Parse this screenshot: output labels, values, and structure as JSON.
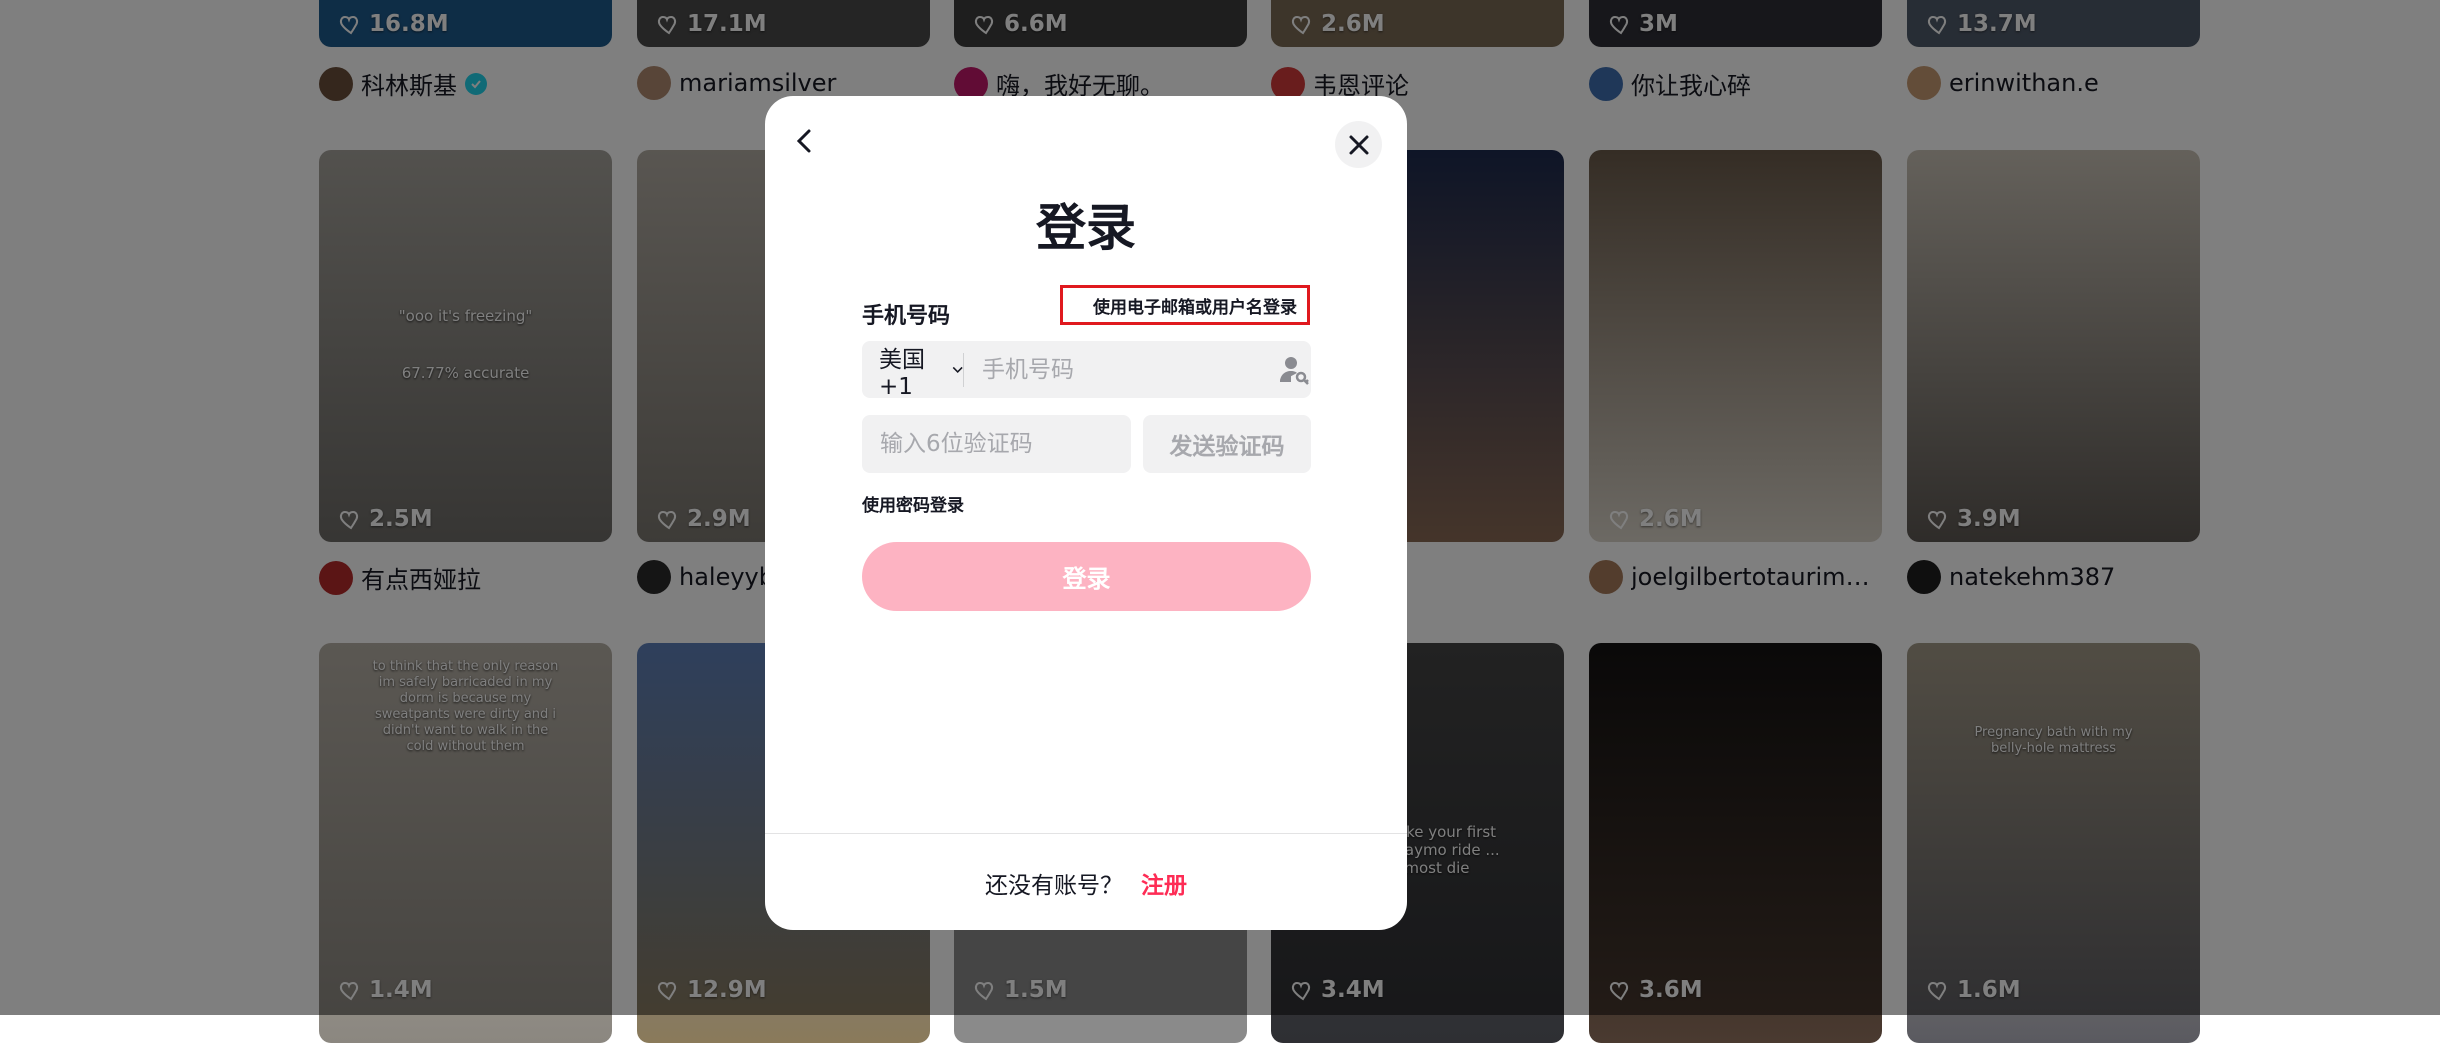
{
  "feed": {
    "row1": [
      {
        "likes": "16.8M",
        "author": "科林斯基",
        "verified": true,
        "thumb": "#1d5a8c",
        "avatar": "#6b4f3a"
      },
      {
        "likes": "17.1M",
        "author": "mariamsilver",
        "verified": false,
        "thumb": "#4a4a4a",
        "avatar": "#b08a70"
      },
      {
        "likes": "6.6M",
        "author": "嗨，我好无聊。",
        "verified": false,
        "thumb": "#3d3d3d",
        "avatar": "#c2186b"
      },
      {
        "likes": "2.6M",
        "author": "韦恩评论",
        "verified": false,
        "thumb": "#7a6a55",
        "avatar": "#d33a3a"
      },
      {
        "likes": "3M",
        "author": "你让我心碎",
        "verified": false,
        "thumb": "#2e2e36",
        "avatar": "#3f6fb0"
      },
      {
        "likes": "13.7M",
        "author": "erinwithan.e",
        "verified": false,
        "thumb": "#4f5a6a",
        "avatar": "#c79a72"
      }
    ],
    "row2": [
      {
        "likes": "2.5M",
        "author": "有点西娅拉",
        "caption": "\"ooo it's freezing\"",
        "caption2": "67.77% accurate",
        "thumb": "#8d8d8a",
        "avatar": "#b72a2a"
      },
      {
        "likes": "2.9M",
        "author": "haleyyb",
        "thumb": "#9a9690",
        "avatar": "#2b2b2b"
      },
      {
        "likes": "",
        "author": "",
        "thumb": "#7a7a7a",
        "avatar": "#888"
      },
      {
        "likes": "",
        "author": "...",
        "thumb": "#2a3b6e",
        "avatar": "#666"
      },
      {
        "likes": "2.6M",
        "author": "joelgilbertotaurime...",
        "thumb": "#b9a98a",
        "avatar": "#a77b5a"
      },
      {
        "likes": "3.9M",
        "author": "natekehm387",
        "thumb": "#6f6862",
        "avatar": "#1e1e1e"
      }
    ],
    "row3": [
      {
        "likes": "1.4M",
        "caption": "to think that the only reason im safely barricaded in my dorm is because my sweatpants were dirty and i didn't want to walk in the cold without them",
        "thumb": "#a8a29a"
      },
      {
        "likes": "12.9M",
        "thumb": "#6b86b5"
      },
      {
        "likes": "1.5M",
        "thumb": "#8a8a8a"
      },
      {
        "likes": "3.4M",
        "caption": "take your first Waymo ride ... almost die",
        "thumb": "#2e2f33"
      },
      {
        "likes": "3.6M",
        "thumb": "#1c1a1a"
      },
      {
        "likes": "1.6M",
        "caption": "Pregnancy bath with my belly-hole mattress",
        "thumb": "#8c8575"
      }
    ]
  },
  "modal": {
    "title": "登录",
    "phone_label": "手机号码",
    "email_link": "使用电子邮箱或用户名登录",
    "country_code": "美国 +1",
    "phone_placeholder": "手机号码",
    "code_placeholder": "输入6位验证码",
    "send_code": "发送验证码",
    "password_login": "使用密码登录",
    "login_button": "登录",
    "no_account": "还没有账号？",
    "signup": "注册"
  },
  "colors": {
    "accent": "#fe2c55",
    "login_disabled": "#fdb3c2",
    "highlight_box": "#e0191e",
    "overlay": "rgba(0,0,0,0.5)"
  }
}
